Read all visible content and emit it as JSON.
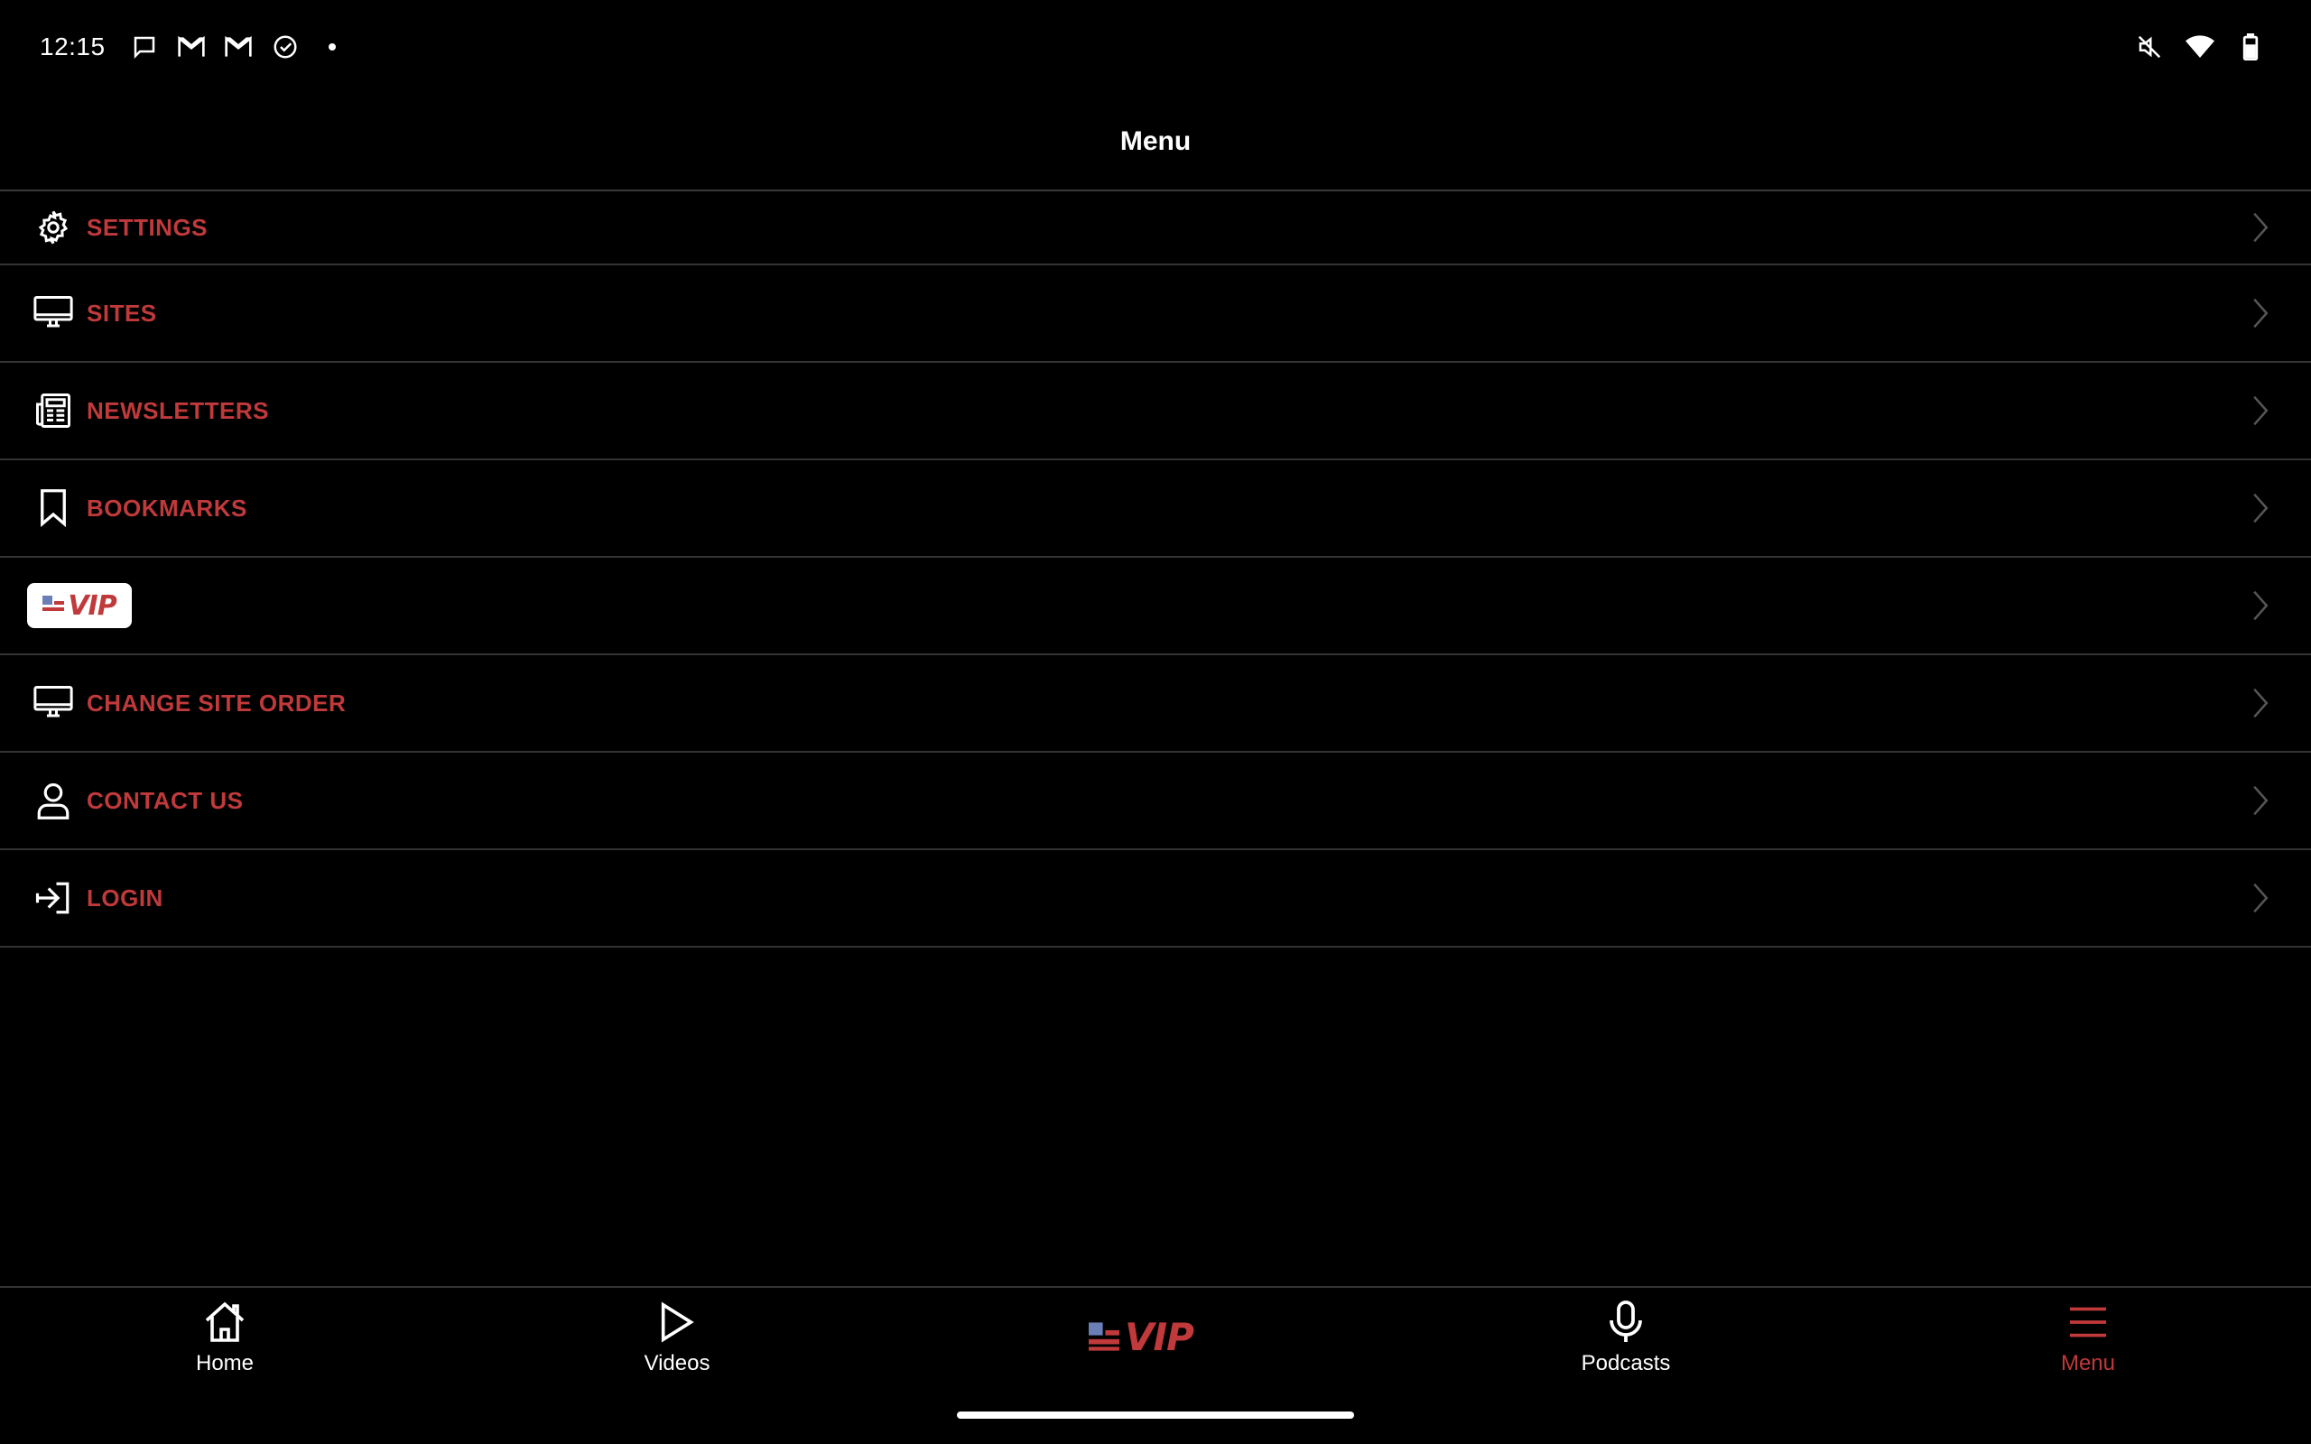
{
  "status_bar": {
    "time": "12:15",
    "left_icons": [
      "message-icon",
      "gmail-icon",
      "gmail-icon",
      "check-circle-icon",
      "dot-icon"
    ],
    "right_icons": [
      "mute-icon",
      "wifi-icon",
      "battery-icon"
    ]
  },
  "header": {
    "title": "Menu"
  },
  "menu": {
    "items": [
      {
        "label": "SETTINGS",
        "icon": "gear-icon"
      },
      {
        "label": "SITES",
        "icon": "monitor-icon"
      },
      {
        "label": "NEWSLETTERS",
        "icon": "newspaper-icon"
      },
      {
        "label": "BOOKMARKS",
        "icon": "bookmark-icon"
      },
      {
        "label": "VIP",
        "icon": "vip-logo"
      },
      {
        "label": "CHANGE SITE ORDER",
        "icon": "monitor-icon"
      },
      {
        "label": "CONTACT US",
        "icon": "user-icon"
      },
      {
        "label": "LOGIN",
        "icon": "login-icon"
      }
    ]
  },
  "bottom_nav": {
    "home": "Home",
    "videos": "Videos",
    "vip": "VIP",
    "podcasts": "Podcasts",
    "menu": "Menu"
  },
  "colors": {
    "accent": "#c0393b",
    "background": "#000000",
    "divider": "#333333"
  }
}
